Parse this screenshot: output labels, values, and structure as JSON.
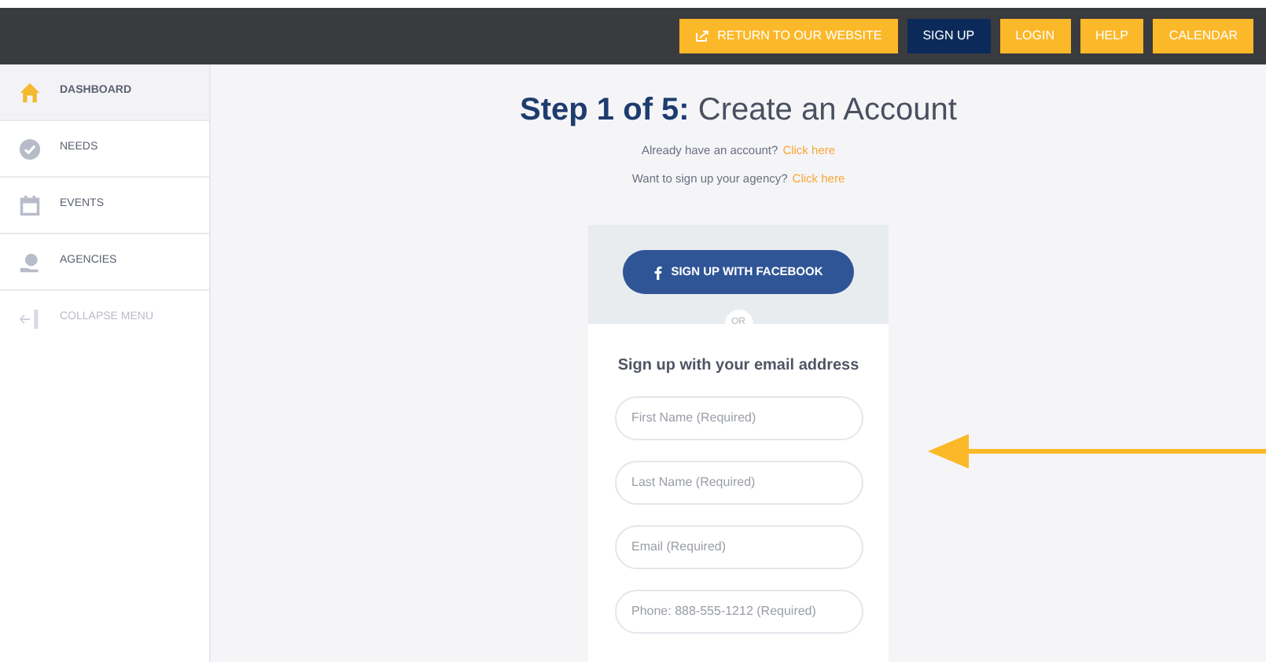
{
  "top_nav": [
    {
      "label": "RETURN TO OUR WEBSITE",
      "kind": "external",
      "selected": false
    },
    {
      "label": "SIGN UP",
      "kind": "plain",
      "selected": true
    },
    {
      "label": "LOGIN",
      "kind": "plain",
      "selected": false
    },
    {
      "label": "HELP",
      "kind": "plain",
      "selected": false
    },
    {
      "label": "CALENDAR",
      "kind": "plain",
      "selected": false
    }
  ],
  "sidebar": {
    "items": [
      {
        "label": "DASHBOARD",
        "kind": "home",
        "selected": true
      },
      {
        "label": "NEEDS",
        "kind": "check",
        "selected": false
      },
      {
        "label": "EVENTS",
        "kind": "calendar",
        "selected": false
      },
      {
        "label": "AGENCIES",
        "kind": "agency",
        "selected": false
      },
      {
        "label": "COLLAPSE MENU",
        "kind": "collapse",
        "selected": false
      }
    ]
  },
  "heading": {
    "step": "Step 1 of 5:",
    "title": "Create an Account"
  },
  "links": [
    {
      "text": "Already have an account?",
      "link": "Click here"
    },
    {
      "text": "Want to sign up your agency?",
      "link": "Click here"
    }
  ],
  "signup_card": {
    "facebook_button": "SIGN UP WITH FACEBOOK",
    "divider": "OR",
    "subtitle": "Sign up with your email address",
    "fields": [
      {
        "placeholder": "First Name (Required)"
      },
      {
        "placeholder": "Last Name (Required)"
      },
      {
        "placeholder": "Email (Required)"
      },
      {
        "placeholder": "Phone: 888-555-1212 (Required)"
      }
    ]
  }
}
